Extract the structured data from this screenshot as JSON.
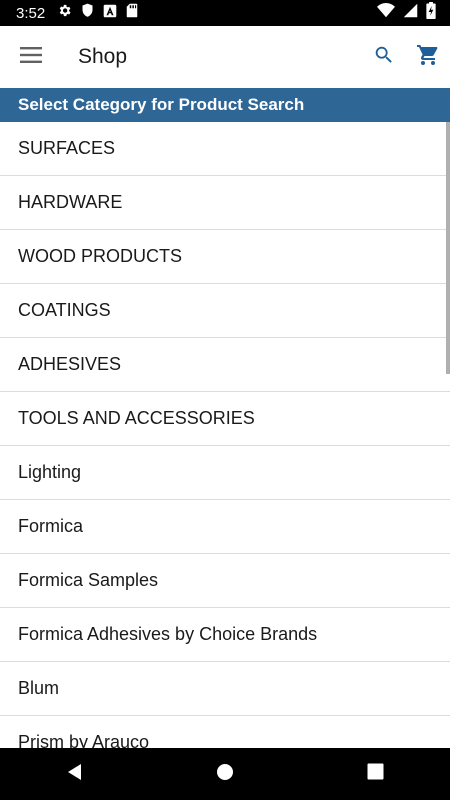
{
  "status_bar": {
    "time": "3:52",
    "icons_left": [
      "gear-icon",
      "shield-icon",
      "a-box-icon",
      "sd-card-icon"
    ],
    "icons_right": [
      "wifi-icon",
      "signal-icon",
      "battery-charging-icon"
    ]
  },
  "app_bar": {
    "title": "Shop",
    "menu_icon": "hamburger-menu-icon",
    "search_icon": "search-icon",
    "cart_icon": "cart-icon",
    "accent_color": "#1f5f99"
  },
  "category_header": {
    "text": "Select Category for Product Search",
    "background": "#2e6696"
  },
  "categories": [
    {
      "label": "SURFACES"
    },
    {
      "label": "HARDWARE"
    },
    {
      "label": "WOOD PRODUCTS"
    },
    {
      "label": "COATINGS"
    },
    {
      "label": "ADHESIVES"
    },
    {
      "label": "TOOLS AND ACCESSORIES"
    },
    {
      "label": "Lighting"
    },
    {
      "label": "Formica"
    },
    {
      "label": "Formica Samples"
    },
    {
      "label": "Formica Adhesives by Choice Brands"
    },
    {
      "label": "Blum"
    },
    {
      "label": "Prism by Arauco"
    }
  ],
  "nav_bar": {
    "icons": [
      "back-icon",
      "home-icon",
      "recents-icon"
    ]
  }
}
